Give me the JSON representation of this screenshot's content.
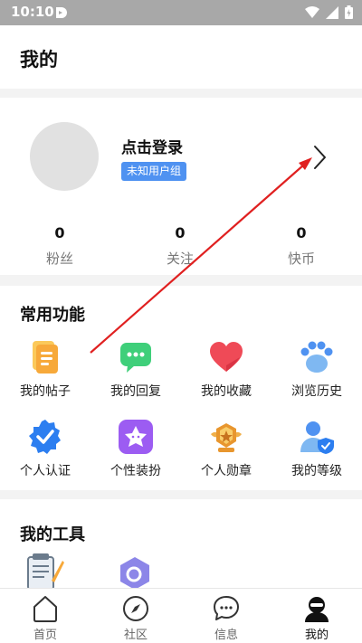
{
  "status_bar": {
    "time": "10:10"
  },
  "header": {
    "title": "我的"
  },
  "profile": {
    "login_text": "点击登录",
    "user_group": "未知用户组",
    "stats": [
      {
        "value": "0",
        "label": "粉丝"
      },
      {
        "value": "0",
        "label": "关注"
      },
      {
        "value": "0",
        "label": "快币"
      }
    ]
  },
  "functions": {
    "title": "常用功能",
    "items": [
      {
        "label": "我的帖子",
        "icon": "document-icon"
      },
      {
        "label": "我的回复",
        "icon": "chat-bubble-icon"
      },
      {
        "label": "我的收藏",
        "icon": "heart-icon"
      },
      {
        "label": "浏览历史",
        "icon": "paw-icon"
      },
      {
        "label": "个人认证",
        "icon": "verified-badge-icon"
      },
      {
        "label": "个性装扮",
        "icon": "star-face-icon"
      },
      {
        "label": "个人勋章",
        "icon": "medal-icon"
      },
      {
        "label": "我的等级",
        "icon": "user-shield-icon"
      }
    ]
  },
  "tools": {
    "title": "我的工具"
  },
  "tabbar": {
    "tabs": [
      {
        "label": "首页",
        "icon": "home-icon"
      },
      {
        "label": "社区",
        "icon": "compass-icon"
      },
      {
        "label": "信息",
        "icon": "message-icon"
      },
      {
        "label": "我的",
        "icon": "profile-icon"
      }
    ]
  },
  "colors": {
    "badge_blue": "#4f92f1",
    "annotation_arrow": "#e02020"
  }
}
